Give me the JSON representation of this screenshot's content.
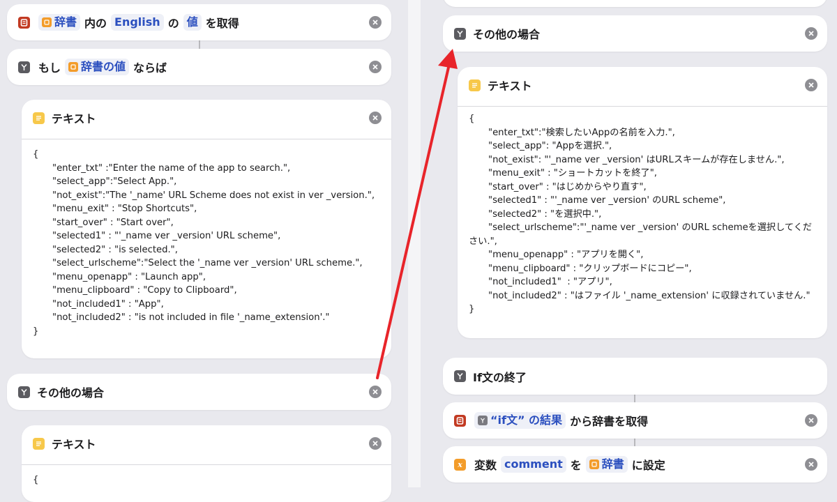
{
  "left": {
    "get_value": {
      "chip1": "辞書",
      "w1": "内の",
      "chip2": "English",
      "w2": "の",
      "chip3": "値",
      "w3": "を取得"
    },
    "if_block": {
      "w1": "もし",
      "chip": "辞書の値",
      "w2": "ならば"
    },
    "text1": {
      "title": "テキスト",
      "lines": [
        "{",
        "\"enter_txt\" :\"Enter the name of the app to search.\",",
        "\"select_app\":\"Select App.\",",
        "\"not_exist\":\"The '_name' URL Scheme does not exist in ver _version.\",",
        "\"menu_exit\" : \"Stop Shortcuts\",",
        "\"start_over\" : \"Start over\",",
        "\"selected1\" : \"'_name ver _version' URL scheme\",",
        "\"selected2\" : \"is selected.\",",
        "\"select_urlscheme\":\"Select the '_name ver _version' URL scheme.\",",
        "\"menu_openapp\" : \"Launch app\",",
        "\"menu_clipboard\" : \"Copy to Clipboard\",",
        "\"not_included1\" : \"App\",",
        "\"not_included2\" : \"is not included in file '_name_extension'.\"",
        "}"
      ]
    },
    "otherwise": {
      "title": "その他の場合"
    },
    "text2": {
      "title": "テキスト",
      "lines": [
        "{"
      ]
    }
  },
  "right": {
    "otherwise": {
      "title": "その他の場合"
    },
    "text": {
      "title": "テキスト",
      "lines": [
        "{",
        "\"enter_txt\":\"検索したいAppの名前を入力.\",",
        "\"select_app\": \"Appを選択.\",",
        "\"not_exist\": \"'_name ver _version' はURLスキームが存在しません.\",",
        "\"menu_exit\" : \"ショートカットを終了\",",
        "\"start_over\" : \"はじめからやり直す\",",
        "\"selected1\" : \"'_name ver _version' のURL scheme\",",
        "\"selected2\" : \"を選択中.\",",
        "\"select_urlscheme\":\"'_name ver _version' のURL schemeを選択してください.\",",
        "\"menu_openapp\" : \"アプリを開く\",",
        "\"menu_clipboard\" : \"クリップボードにコピー\",",
        "\"not_included1\"  : \"アプリ\",",
        "\"not_included2\" : \"はファイル '_name_extension' に収録されていません.\"",
        "}"
      ]
    },
    "end_if": {
      "title": "If文の終了"
    },
    "get_dict": {
      "chip": "“if文” の結果",
      "w": "から辞書を取得"
    },
    "set_var": {
      "w1": "変数",
      "chip1": "comment",
      "w2": "を",
      "chip2": "辞書",
      "w3": "に設定"
    }
  },
  "colors": {
    "accent_red_arrow": "#e8242a",
    "chip_text": "#2b4fbf"
  }
}
